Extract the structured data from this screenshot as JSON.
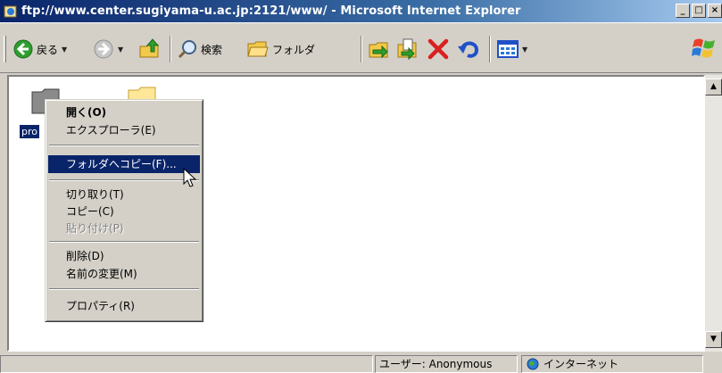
{
  "window": {
    "title": "ftp://www.center.sugiyama-u.ac.jp:2121/www/ - Microsoft Internet Explorer",
    "controls": {
      "minimize": "_",
      "maximize": "□",
      "close": "×"
    }
  },
  "toolbar": {
    "back_label": "戻る",
    "search_label": "検索",
    "folders_label": "フォルダ",
    "icons": [
      "back-arrow-icon",
      "forward-arrow-icon",
      "up-folder-icon",
      "search-icon",
      "folders-icon",
      "move-to-icon",
      "copy-to-icon",
      "delete-icon",
      "undo-icon",
      "views-icon",
      "windows-logo-icon"
    ]
  },
  "content": {
    "file_label": "pro"
  },
  "context_menu": {
    "items": [
      {
        "label": "開く(O)",
        "bold": true
      },
      {
        "label": "エクスプローラ(E)"
      },
      {
        "label": "フォルダへコピー(F)...",
        "selected": true
      },
      {
        "label": "切り取り(T)"
      },
      {
        "label": "コピー(C)"
      },
      {
        "label": "貼り付け(P)",
        "disabled": true
      },
      {
        "label": "削除(D)"
      },
      {
        "label": "名前の変更(M)"
      },
      {
        "label": "プロパティ(R)"
      }
    ]
  },
  "statusbar": {
    "user": "ユーザー: Anonymous",
    "zone": "インターネット"
  },
  "colors": {
    "titlebar_start": "#0a246a",
    "selection": "#0a246a",
    "back_green": "#2e9e2e",
    "delete_red": "#d92020",
    "undo_blue": "#2050c8"
  }
}
